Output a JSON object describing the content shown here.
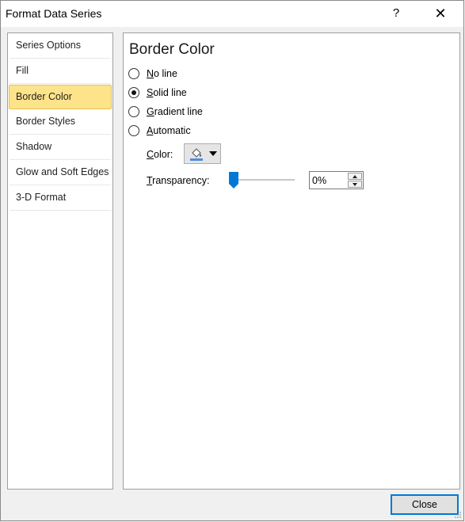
{
  "window": {
    "title": "Format Data Series",
    "help_label": "?",
    "close_label": "✕"
  },
  "sidebar": {
    "items": [
      {
        "label": "Series Options",
        "selected": false
      },
      {
        "label": "Fill",
        "selected": false
      },
      {
        "label": "Border Color",
        "selected": true
      },
      {
        "label": "Border Styles",
        "selected": false
      },
      {
        "label": "Shadow",
        "selected": false
      },
      {
        "label": "Glow and Soft Edges",
        "selected": false
      },
      {
        "label": "3-D Format",
        "selected": false
      }
    ]
  },
  "panel": {
    "title": "Border Color",
    "options": [
      {
        "label_first": "N",
        "label_rest": "o line",
        "checked": false
      },
      {
        "label_first": "S",
        "label_rest": "olid line",
        "checked": true
      },
      {
        "label_first": "G",
        "label_rest": "radient line",
        "checked": false
      },
      {
        "label_first": "A",
        "label_rest": "utomatic",
        "checked": false
      }
    ],
    "color_label_first": "C",
    "color_label_rest": "olor:",
    "color_icon": "paint-bucket-icon",
    "transparency_label_first": "T",
    "transparency_label_rest": "ransparency:",
    "transparency_value": "0%",
    "transparency_fraction": 0
  },
  "footer": {
    "close_label": "Close"
  },
  "colors": {
    "selected_bg": "#fde38a",
    "accent": "#0078d7",
    "bucket_line": "#4a90d9"
  }
}
